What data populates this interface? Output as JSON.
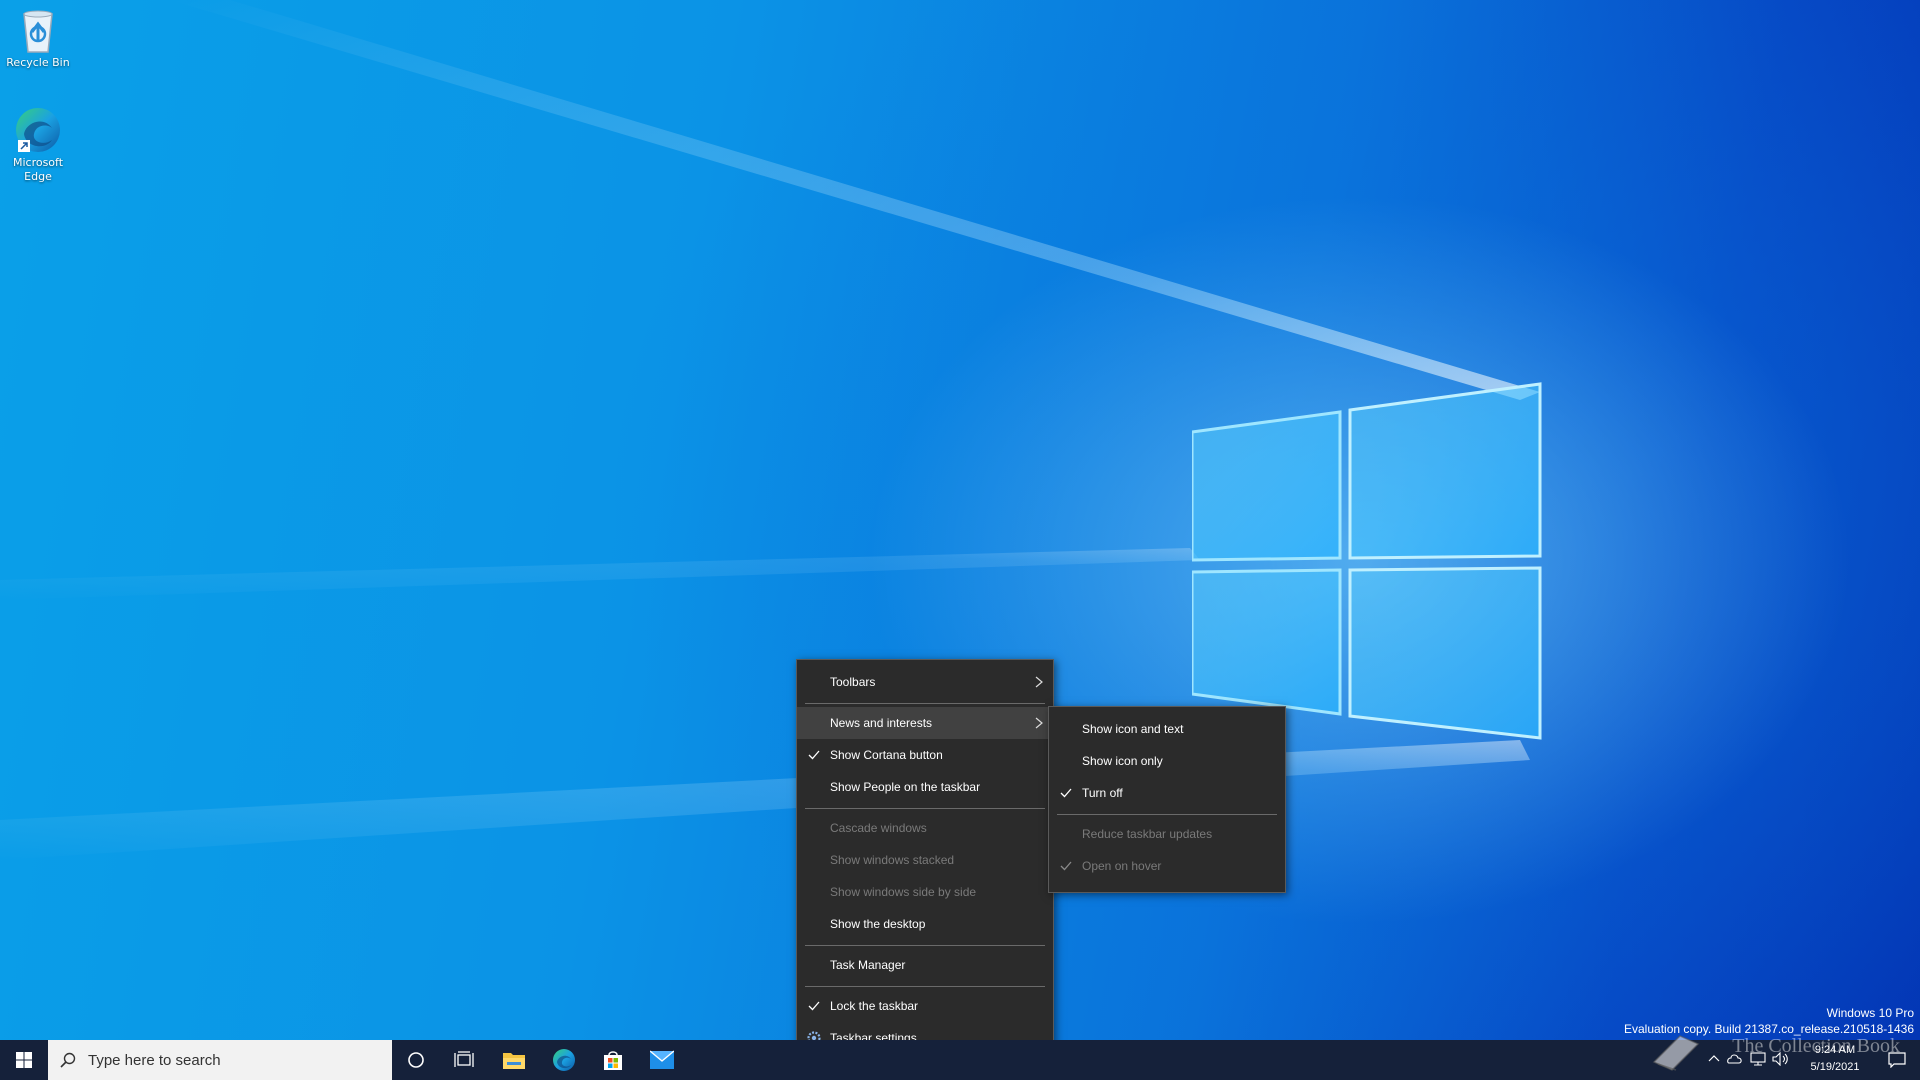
{
  "desktop": {
    "icons": [
      {
        "label": "Recycle Bin",
        "icon": "recycle-bin-icon"
      },
      {
        "label": "Microsoft Edge",
        "icon": "edge-icon"
      }
    ],
    "watermark": {
      "line1": "Windows 10 Pro",
      "line2": "Evaluation copy. Build 21387.co_release.210518-1436"
    },
    "overlay_text": "The Collection Book"
  },
  "context_menu": {
    "items": [
      {
        "label": "Toolbars",
        "submenu": true
      },
      {
        "label": "News and interests",
        "submenu": true,
        "highlighted": true
      },
      {
        "label": "Show Cortana button",
        "checked": true
      },
      {
        "label": "Show People on the taskbar"
      },
      {
        "label": "Cascade windows",
        "disabled": true
      },
      {
        "label": "Show windows stacked",
        "disabled": true
      },
      {
        "label": "Show windows side by side",
        "disabled": true
      },
      {
        "label": "Show the desktop"
      },
      {
        "label": "Task Manager"
      },
      {
        "label": "Lock the taskbar",
        "checked": true
      },
      {
        "label": "Taskbar settings",
        "icon": "gear-icon"
      }
    ]
  },
  "submenu": {
    "items": [
      {
        "label": "Show icon and text"
      },
      {
        "label": "Show icon only"
      },
      {
        "label": "Turn off",
        "checked": true
      },
      {
        "label": "Reduce taskbar updates",
        "disabled": true
      },
      {
        "label": "Open on hover",
        "checked": true,
        "disabled": true
      }
    ]
  },
  "taskbar": {
    "search_placeholder": "Type here to search",
    "pinned": [
      "cortana-icon",
      "task-view-icon",
      "file-explorer-icon",
      "edge-icon",
      "store-icon",
      "mail-icon"
    ],
    "clock": {
      "time": "9:24 AM",
      "date": "5/19/2021"
    }
  },
  "colors": {
    "taskbar": "#15213a",
    "menu_bg": "#2b2b2b",
    "menu_hover": "#414141",
    "disabled_text": "#7a7a7a"
  }
}
